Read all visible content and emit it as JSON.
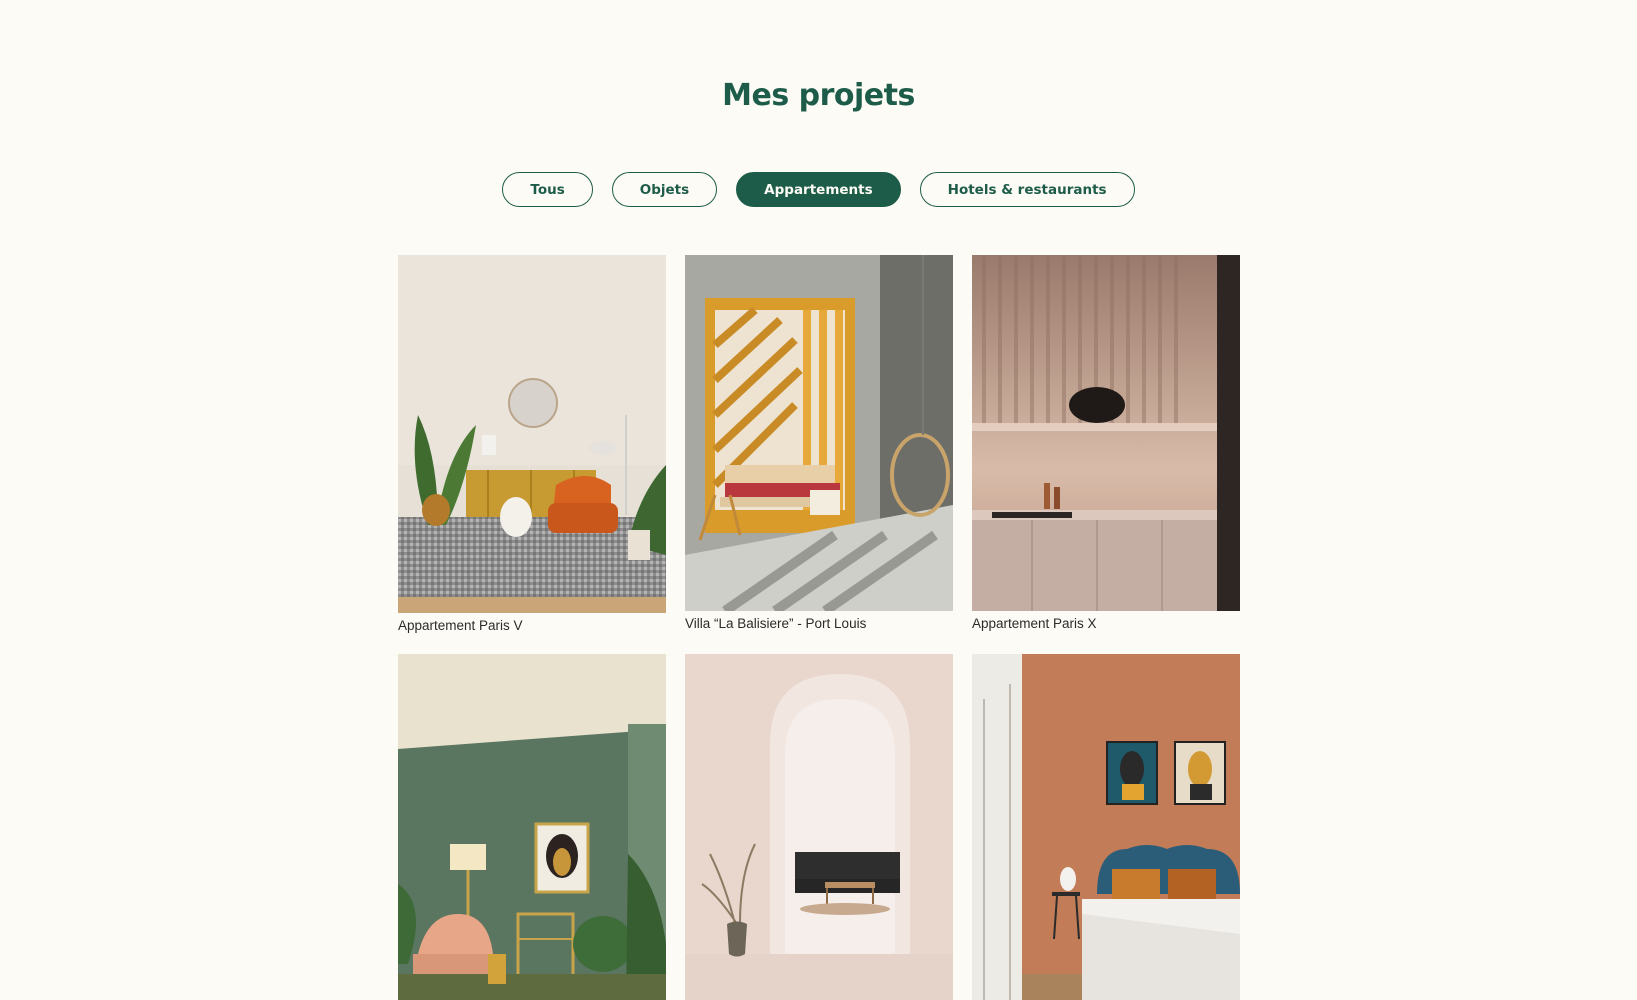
{
  "page": {
    "title": "Mes projets",
    "accent_color": "#1E5C4A",
    "background_color": "#FDFBF5"
  },
  "filters": [
    {
      "label": "Tous",
      "active": false
    },
    {
      "label": "Objets",
      "active": false
    },
    {
      "label": "Appartements",
      "active": true
    },
    {
      "label": "Hotels & restaurants",
      "active": false
    }
  ],
  "projects": [
    {
      "caption": "Appartement Paris V",
      "image": "living-room-orange-armchair-plants"
    },
    {
      "caption": "Villa “La Balisiere” - Port Louis",
      "image": "sunlit-lounge-wooden-screen-hanging-chair"
    },
    {
      "caption": "Appartement Paris X",
      "image": "kitchen-wood-panels-black-lamp"
    },
    {
      "caption": "",
      "image": "green-wall-living-room-pink-chair"
    },
    {
      "caption": "",
      "image": "pink-arch-hallway-black-sofa"
    },
    {
      "caption": "",
      "image": "terracotta-bedroom-blue-headboard"
    }
  ]
}
